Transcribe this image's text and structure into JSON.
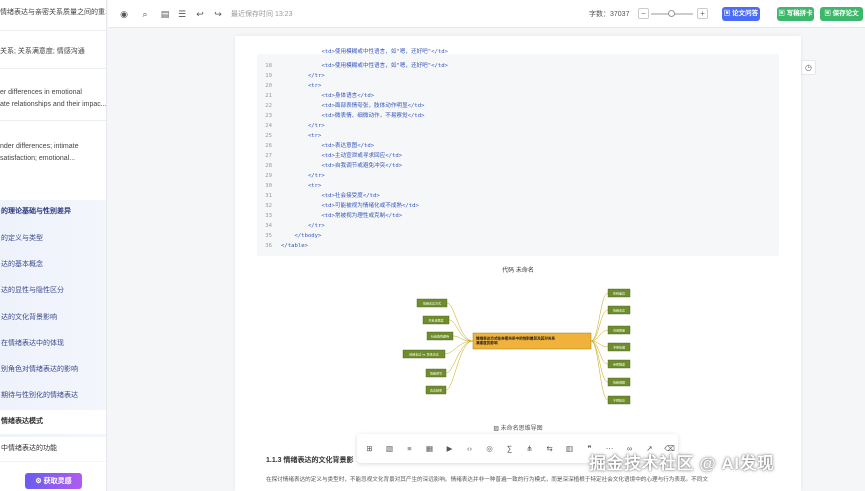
{
  "sidebar": {
    "top_items": [
      "情绪表达与亲密关系质量之间的重...",
      "关系; 关系满意度; 情感沟通",
      "er differences in emotional",
      "ate relationships and their impac...",
      "nder differences; intimate",
      "satisfaction; emotional..."
    ],
    "outline": [
      "的理论基础与性别差异",
      "的定义与类型",
      "达的基本概念",
      "达的显性与隐性区分",
      "达的文化背景影响",
      "在情绪表达中的体现",
      "别角色对情绪表达的影响",
      "期待与性别化的情绪表达",
      "情绪表达模式",
      "中情绪表达的功能"
    ],
    "inspire_icon": "gear-icon",
    "inspire_label": "获取灵感"
  },
  "toolbar": {
    "save_time": "最近保存时间 13:23",
    "word_count": "字数：37037",
    "zoom_minus": "−",
    "zoom_plus": "+",
    "zoom_level": 0.5,
    "btn_qa": "论文问答",
    "btn_merge": "写稿拼卡",
    "btn_save": "保存论文"
  },
  "code": {
    "lines": [
      {
        "n": "",
        "t": "            <td>使用模糊或中性语言，如\"嗯，还好吧\"</td>"
      },
      {
        "n": "18",
        "t": "            <td>使用模糊或中性语言，如\"嗯，还好吧\"</td>"
      },
      {
        "n": "19",
        "t": "        </tr>"
      },
      {
        "n": "20",
        "t": "        <tr>"
      },
      {
        "n": "21",
        "t": "            <td>身体语言</td>"
      },
      {
        "n": "22",
        "t": "            <td>面部表情夸张，肢体动作明显</td>"
      },
      {
        "n": "23",
        "t": "            <td>微表情、细微动作，不易察觉</td>"
      },
      {
        "n": "24",
        "t": "        </tr>"
      },
      {
        "n": "25",
        "t": "        <tr>"
      },
      {
        "n": "26",
        "t": "            <td>表达意图</td>"
      },
      {
        "n": "27",
        "t": "            <td>主动宣泄或寻求回应</td>"
      },
      {
        "n": "28",
        "t": "            <td>自我调节或避免冲突</td>"
      },
      {
        "n": "29",
        "t": "        </tr>"
      },
      {
        "n": "30",
        "t": "        <tr>"
      },
      {
        "n": "31",
        "t": "            <td>社会接受度</td>"
      },
      {
        "n": "32",
        "t": "            <td>可能被视为情绪化或不成熟</td>"
      },
      {
        "n": "33",
        "t": "            <td>常被视为理性或克制</td>"
      },
      {
        "n": "34",
        "t": "        </tr>"
      },
      {
        "n": "35",
        "t": "    </tbody>"
      },
      {
        "n": "36",
        "t": "</table>"
      }
    ],
    "caption": "代码   未命名"
  },
  "mindmap": {
    "center": "情绪表达方式在亲密关系中的性别差异及其对关系满意度的影响",
    "left": [
      "情绪表达方式",
      "关系满意度",
      "社会角色期待",
      "情绪表达 vs. 隐性表达",
      "情绪调节",
      "表达频率"
    ],
    "right": [
      "性别差异",
      "情绪表达",
      "沟通质量",
      "冲突处理",
      "亲密程度",
      "情绪调解",
      "干预建议"
    ],
    "caption": "未命名思维导图"
  },
  "section": {
    "heading": "1.1.3 情绪表达的文化背景影",
    "body": "在探讨情绪表达的定义与类型时，不能忽视文化背景对其产生的深远影响。情绪表达并非一种普遍一致的行为模式，而是深深植根于特定社会文化语境中的心理与行为表现。不同文"
  },
  "floating_toolbar": {
    "icons": [
      "table-icon",
      "image-icon",
      "list-icon",
      "grid-icon",
      "video-icon",
      "code-icon",
      "location-icon",
      "formula-icon",
      "tree-icon",
      "flow-icon",
      "chart-icon",
      "quote-icon",
      "more-icon",
      "link-icon",
      "arrow-icon",
      "trash-icon"
    ]
  },
  "watermark": "掘金技术社区 @ AI发现",
  "colors": {
    "accent_blue": "#4a6cf7",
    "accent_green": "#3bb86a",
    "mindmap_node": "#6f8d2c",
    "mindmap_center": "#f0b23a",
    "code_text": "#3355bb"
  }
}
